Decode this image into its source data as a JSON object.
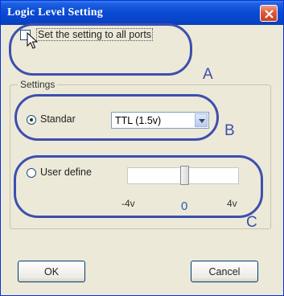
{
  "window": {
    "title": "Logic Level Setting"
  },
  "apply_all": {
    "label": "Set the setting to all ports",
    "checked": false
  },
  "settings_group": {
    "label": "Settings"
  },
  "standard": {
    "label": "Standar",
    "selected": true,
    "dropdown_value": "TTL (1.5v)"
  },
  "user_define": {
    "label": "User define",
    "selected": false,
    "slider_min_label": "-4v",
    "slider_max_label": "4v",
    "slider_value_label": "0",
    "slider_fraction": 0.5
  },
  "annotations": {
    "a": "A",
    "b": "B",
    "c": "C"
  },
  "buttons": {
    "ok": "OK",
    "cancel": "Cancel"
  },
  "colors": {
    "annotation": "#3d4fae",
    "titlebar": "#0a4ad3",
    "close": "#e0583a"
  }
}
